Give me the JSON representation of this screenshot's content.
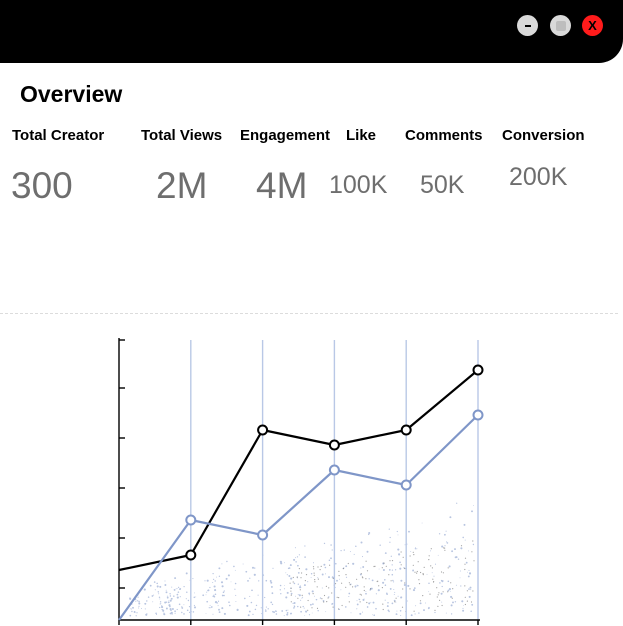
{
  "window": {
    "minimize_label": "-",
    "maximize_label": "",
    "close_label": "X"
  },
  "page": {
    "title": "Overview"
  },
  "stats": [
    {
      "label": "Total Creator",
      "value": "300"
    },
    {
      "label": "Total Views",
      "value": "2M"
    },
    {
      "label": "Engagement",
      "value": "4M"
    },
    {
      "label": "Like",
      "value": "100K"
    },
    {
      "label": "Comments",
      "value": "50K"
    },
    {
      "label": "Conversion",
      "value": "200K"
    }
  ],
  "colors": {
    "titlebar": "#000000",
    "close": "#ff1b1b",
    "series_dark": "#000000",
    "series_blue": "#7f96c8",
    "gridline": "#b9c8e6",
    "stat_value": "#6e6e6e"
  },
  "icons": {
    "minimize": "minimize-icon",
    "maximize": "maximize-icon",
    "close": "close-icon"
  },
  "chart_data": {
    "type": "line",
    "x": [
      0,
      1,
      2,
      3,
      4,
      5
    ],
    "ylim": [
      0,
      5.6
    ],
    "xlim": [
      0,
      5
    ],
    "series": [
      {
        "values": [
          1.0,
          1.3,
          3.8,
          3.5,
          3.8,
          5.0
        ]
      },
      {
        "values": [
          0.0,
          2.0,
          1.7,
          3.0,
          2.7,
          4.1
        ]
      }
    ],
    "grid": true
  }
}
